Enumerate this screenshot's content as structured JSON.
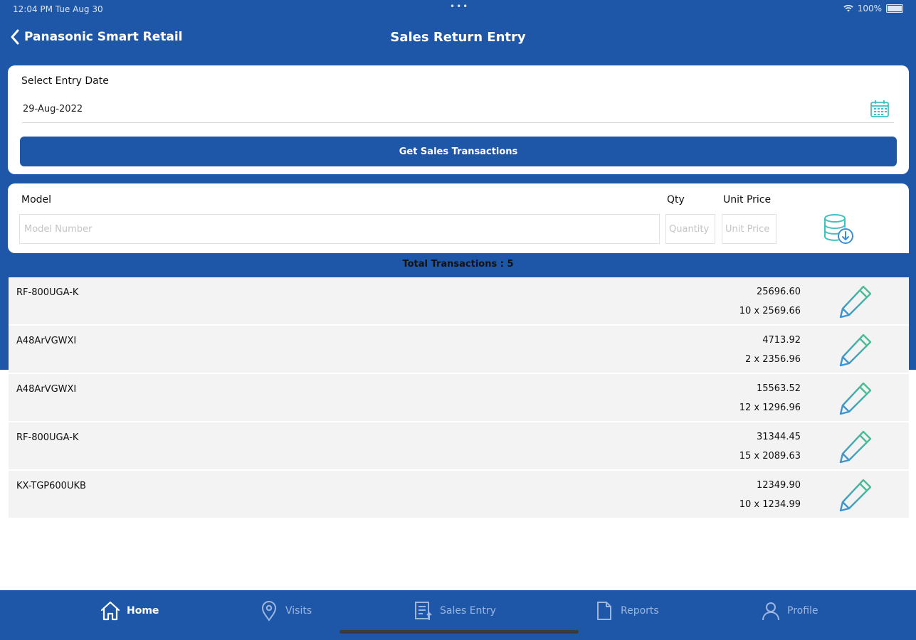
{
  "status_bar": {
    "time": "12:04 PM   Tue Aug 30",
    "dots": "•••",
    "battery": "100%"
  },
  "nav": {
    "back_label": "Panasonic Smart Retail",
    "title": "Sales Return Entry"
  },
  "entry_date": {
    "label": "Select Entry Date",
    "value": "29-Aug-2022",
    "button_label": "Get Sales Transactions"
  },
  "entry_form": {
    "model_label": "Model",
    "model_placeholder": "Model Number",
    "qty_label": "Qty",
    "qty_placeholder": "Quantity",
    "price_label": "Unit Price",
    "price_placeholder": "Unit Price"
  },
  "transactions": {
    "total_label": "Total Transactions : 5",
    "rows": [
      {
        "model": "RF-800UGA-K",
        "total": "25696.60",
        "calc": "10 x 2569.66"
      },
      {
        "model": "A48ArVGWXI",
        "total": "4713.92",
        "calc": "2 x 2356.96"
      },
      {
        "model": "A48ArVGWXI",
        "total": "15563.52",
        "calc": "12 x 1296.96"
      },
      {
        "model": "RF-800UGA-K",
        "total": "31344.45",
        "calc": "15 x 2089.63"
      },
      {
        "model": "KX-TGP600UKB",
        "total": "12349.90",
        "calc": "10 x 1234.99"
      }
    ]
  },
  "tabs": [
    {
      "label": "Home",
      "icon": "home-icon",
      "active": true
    },
    {
      "label": "Visits",
      "icon": "location-pin-icon"
    },
    {
      "label": "Sales Entry",
      "icon": "sales-entry-icon"
    },
    {
      "label": "Reports",
      "icon": "document-icon"
    },
    {
      "label": "Profile",
      "icon": "person-icon"
    }
  ],
  "colors": {
    "primary": "#1e56a8",
    "row_bg": "#f3f3f3",
    "tab_inactive": "#9eb6dd",
    "icon_teal": "#3fc1c0"
  }
}
